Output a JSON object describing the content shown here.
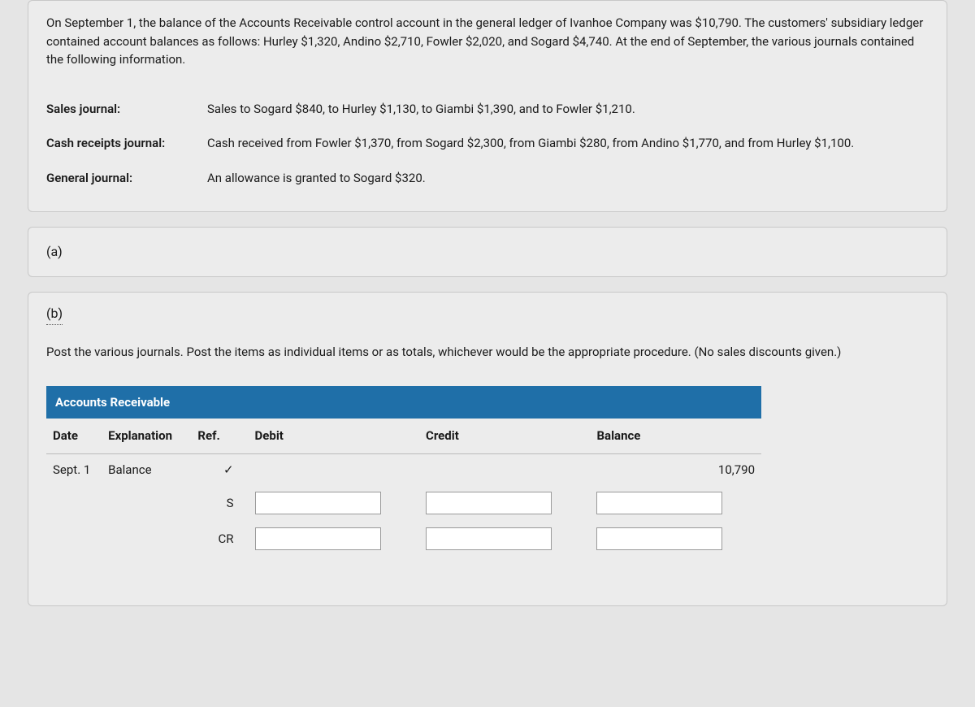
{
  "intro": "On September 1, the balance of the Accounts Receivable control account in the general ledger of Ivanhoe Company was $10,790. The customers' subsidiary ledger contained account balances as follows: Hurley $1,320, Andino $2,710, Fowler $2,020, and Sogard $4,740. At the end of September, the various journals contained the following information.",
  "journals": [
    {
      "label": "Sales journal:",
      "text": "Sales to Sogard $840, to Hurley $1,130, to Giambi $1,390, and to Fowler $1,210."
    },
    {
      "label": "Cash receipts journal:",
      "text": "Cash received from Fowler $1,370, from Sogard $2,300, from Giambi $280, from Andino $1,770, and from Hurley $1,100."
    },
    {
      "label": "General journal:",
      "text": "An allowance is granted to Sogard $320."
    }
  ],
  "part_a": "(a)",
  "part_b": "(b)",
  "instructions": "Post the various journals. Post the items as individual items or as totals, whichever would be the appropriate procedure. (No sales discounts given.)",
  "table": {
    "title": "Accounts Receivable",
    "headers": {
      "date": "Date",
      "explanation": "Explanation",
      "ref": "Ref.",
      "debit": "Debit",
      "credit": "Credit",
      "balance": "Balance"
    },
    "rows": [
      {
        "date": "Sept. 1",
        "explanation": "Balance",
        "ref": "✓",
        "debit": "",
        "credit": "",
        "balance": "10,790",
        "inputs": false
      },
      {
        "date": "",
        "explanation": "",
        "ref": "S",
        "debit": "",
        "credit": "",
        "balance": "",
        "inputs": true
      },
      {
        "date": "",
        "explanation": "",
        "ref": "CR",
        "debit": "",
        "credit": "",
        "balance": "",
        "inputs": true
      }
    ]
  }
}
